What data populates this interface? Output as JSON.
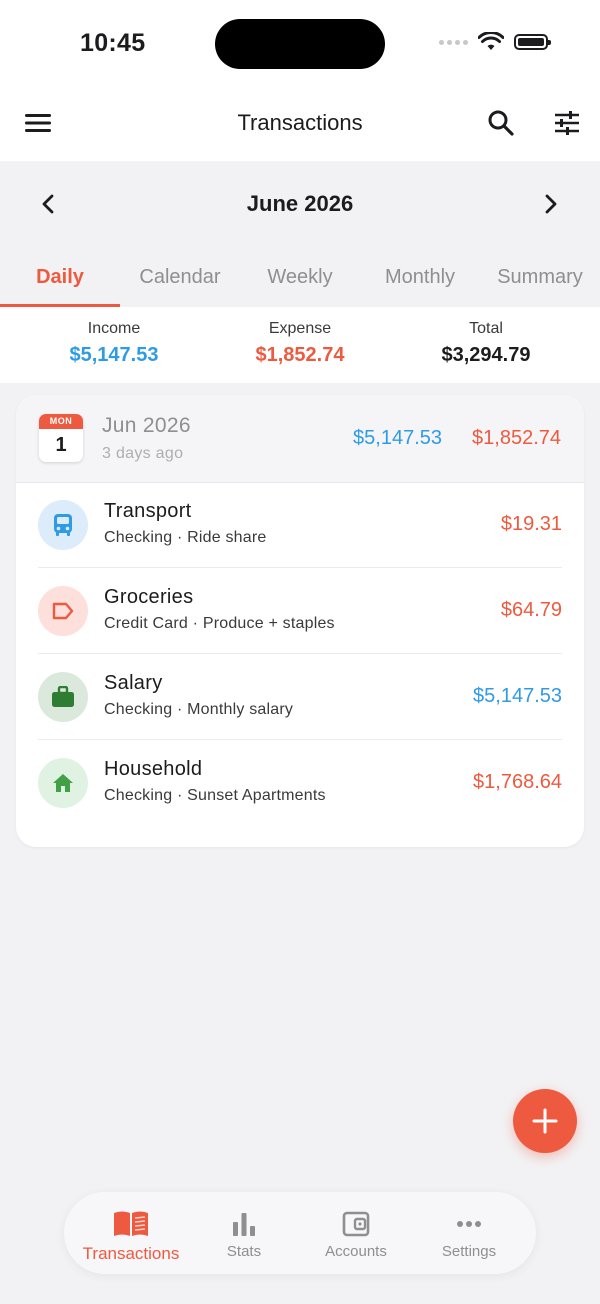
{
  "status_bar": {
    "time": "10:45"
  },
  "header": {
    "title": "Transactions",
    "menu_icon": "menu-icon",
    "search_icon": "search-icon",
    "filter_icon": "sliders-icon"
  },
  "month_nav": {
    "label": "June 2026",
    "prev_icon": "chevron-left-icon",
    "next_icon": "chevron-right-icon"
  },
  "tabs": [
    {
      "label": "Daily",
      "active": true
    },
    {
      "label": "Calendar",
      "active": false
    },
    {
      "label": "Weekly",
      "active": false
    },
    {
      "label": "Monthly",
      "active": false
    },
    {
      "label": "Summary",
      "active": false
    }
  ],
  "summary": {
    "income_label": "Income",
    "income_value": "$5,147.53",
    "expense_label": "Expense",
    "expense_value": "$1,852.74",
    "total_label": "Total",
    "total_value": "$3,294.79"
  },
  "day_group": {
    "weekday_badge": "MON",
    "day_number": "1",
    "title": "Jun 2026",
    "relative": "3 days ago",
    "income": "$5,147.53",
    "expense": "$1,852.74"
  },
  "transactions": [
    {
      "category": "Transport",
      "meta": "Checking · Ride share",
      "amount": "$19.31",
      "type": "expense",
      "icon": "bus-icon",
      "icon_color": "#2f9be6",
      "icon_bg": "#dcecfb"
    },
    {
      "category": "Groceries",
      "meta": "Credit Card · Produce + staples",
      "amount": "$64.79",
      "type": "expense",
      "icon": "tag-icon",
      "icon_color": "#ee5a3f",
      "icon_bg": "#fde0dc"
    },
    {
      "category": "Salary",
      "meta": "Checking · Monthly salary",
      "amount": "$5,147.53",
      "type": "income",
      "icon": "briefcase-icon",
      "icon_color": "#2e7d32",
      "icon_bg": "#dbe9dc"
    },
    {
      "category": "Household",
      "meta": "Checking · Sunset Apartments",
      "amount": "$1,768.64",
      "type": "expense",
      "icon": "home-icon",
      "icon_color": "#43a047",
      "icon_bg": "#e0f2e1"
    }
  ],
  "fab": {
    "icon": "plus-icon"
  },
  "bottom_nav": [
    {
      "label": "Transactions",
      "icon": "book-icon",
      "active": true
    },
    {
      "label": "Stats",
      "icon": "bar-chart-icon",
      "active": false
    },
    {
      "label": "Accounts",
      "icon": "wallet-icon",
      "active": false
    },
    {
      "label": "Settings",
      "icon": "more-dots-icon",
      "active": false
    }
  ],
  "colors": {
    "accent": "#ee5a3f",
    "income": "#2f9be6",
    "expense": "#ee5a3f"
  }
}
